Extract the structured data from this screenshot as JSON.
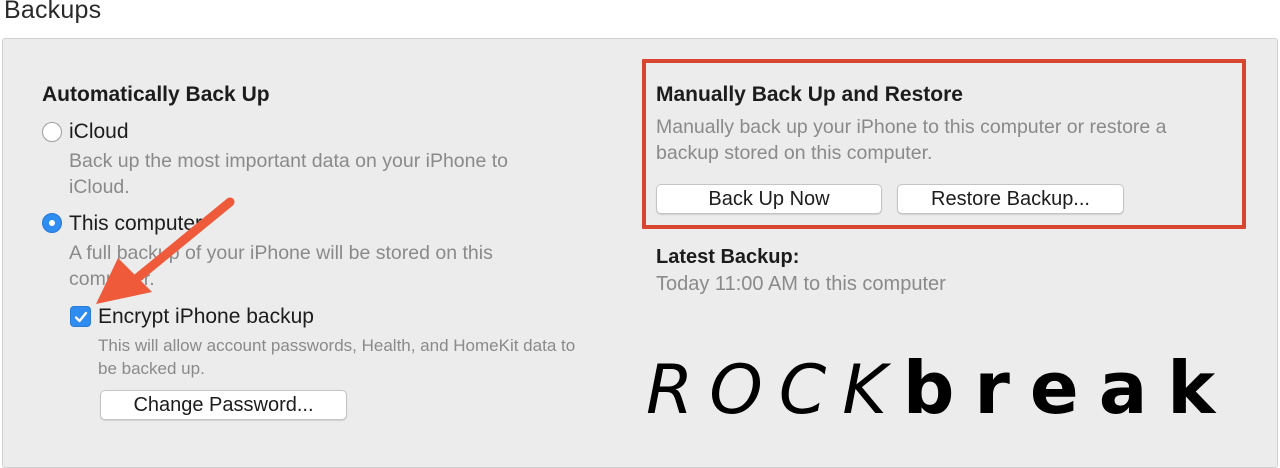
{
  "section_title": "Backups",
  "auto_backup": {
    "heading": "Automatically Back Up",
    "icloud": {
      "label": "iCloud",
      "selected": false,
      "desc_line1": "Back up the most important data on your iPhone to",
      "desc_line2": "iCloud."
    },
    "computer": {
      "label": "This computer",
      "selected": true,
      "desc_line1": "A full backup of your iPhone will be stored on this",
      "desc_line2": "computer."
    },
    "encrypt": {
      "label": "Encrypt iPhone backup",
      "checked": true,
      "desc_line1": "This will allow account passwords, Health, and HomeKit data to",
      "desc_line2": "be backed up."
    },
    "change_password_label": "Change Password..."
  },
  "manual": {
    "heading": "Manually Back Up and Restore",
    "desc_line1": "Manually back up your iPhone to this computer or restore a",
    "desc_line2": "backup stored on this computer.",
    "back_up_now_label": "Back Up Now",
    "restore_label": "Restore Backup..."
  },
  "latest_backup": {
    "label": "Latest Backup:",
    "value": "Today 11:00 AM to this computer"
  },
  "watermark": {
    "part1": "ROCK",
    "part2": "break"
  },
  "colors": {
    "accent_blue": "#2f8cf0",
    "highlight_red": "#d9462f",
    "arrow_red": "#ef5a3a",
    "panel_bg": "#ececec"
  },
  "icons": {
    "annotation_arrow": "red-arrow-icon",
    "checkmark": "checkmark-icon"
  }
}
